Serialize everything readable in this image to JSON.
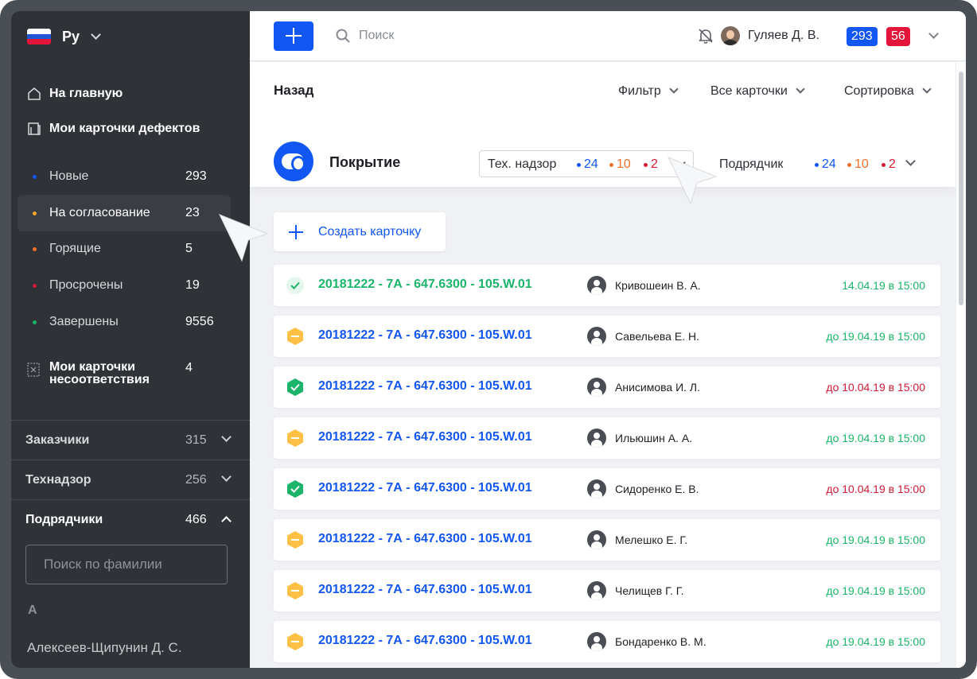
{
  "colors": {
    "accent": "#1256f4",
    "red": "#e4143b",
    "green": "#1bb46a",
    "orange": "#f0712c",
    "yellow": "#ffc046"
  },
  "sidebar": {
    "language": "Ру",
    "home": "На главную",
    "my_defects": "Мои карточки дефектов",
    "statuses": [
      {
        "label": "Новые",
        "count": "293",
        "color": "#1256f4"
      },
      {
        "label": "На согласование",
        "count": "23",
        "color": "#f5a623"
      },
      {
        "label": "Горящие",
        "count": "5",
        "color": "#f0712c"
      },
      {
        "label": "Просрочены",
        "count": "19",
        "color": "#d21a36"
      },
      {
        "label": "Завершены",
        "count": "9556",
        "color": "#1bb46a"
      }
    ],
    "nonconformity": {
      "label": "Мои карточки несоответствия",
      "count": "4"
    },
    "sections": [
      {
        "label": "Заказчики",
        "count": "315"
      },
      {
        "label": "Технадзор",
        "count": "256"
      },
      {
        "label": "Подрядчики",
        "count": "466"
      }
    ],
    "search_placeholder": "Поиск по фамилии",
    "letter": "А",
    "person": "Алексеев-Щипунин Д. С."
  },
  "topbar": {
    "search_placeholder": "Поиск",
    "user_name": "Гуляев Д. В.",
    "badge_blue": "293",
    "badge_red": "56"
  },
  "subbar": {
    "back": "Назад",
    "filter": "Фильтр",
    "all_cards": "Все карточки",
    "sort": "Сортировка",
    "title": "Покрытие",
    "tech": {
      "label": "Тех. надзор",
      "blue": "24",
      "orange": "10",
      "red": "2"
    },
    "contractor": {
      "label": "Подрядчик",
      "blue": "24",
      "orange": "10",
      "red": "2"
    }
  },
  "create_label": "Создать карточку",
  "cards": [
    {
      "status": "check-light",
      "code": "20181222 - 7А - 647.6300 - 105.W.01",
      "person": "Кривошеин В. А.",
      "date": "14.04.19 в 15:00",
      "date_color": "green"
    },
    {
      "status": "pending",
      "code": "20181222 - 7А - 647.6300 - 105.W.01",
      "person": "Савельева Е. Н.",
      "date": "до 19.04.19 в 15:00",
      "date_color": "green"
    },
    {
      "status": "approved",
      "code": "20181222 - 7А - 647.6300 - 105.W.01",
      "person": "Анисимова И. Л.",
      "date": "до 10.04.19 в 15:00",
      "date_color": "red"
    },
    {
      "status": "pending",
      "code": "20181222 - 7А - 647.6300 - 105.W.01",
      "person": "Ильюшин А. А.",
      "date": "до 19.04.19 в 15:00",
      "date_color": "green"
    },
    {
      "status": "approved",
      "code": "20181222 - 7А - 647.6300 - 105.W.01",
      "person": "Сидоренко Е. В.",
      "date": "до 10.04.19 в 15:00",
      "date_color": "red"
    },
    {
      "status": "pending",
      "code": "20181222 - 7А - 647.6300 - 105.W.01",
      "person": "Мелешко Е. Г.",
      "date": "до 19.04.19 в 15:00",
      "date_color": "green"
    },
    {
      "status": "pending",
      "code": "20181222 - 7А - 647.6300 - 105.W.01",
      "person": "Челищев Г. Г.",
      "date": "до 19.04.19 в 15:00",
      "date_color": "green"
    },
    {
      "status": "pending",
      "code": "20181222 - 7А - 647.6300 - 105.W.01",
      "person": "Бондаренко В. М.",
      "date": "до 19.04.19 в 15:00",
      "date_color": "green"
    }
  ]
}
